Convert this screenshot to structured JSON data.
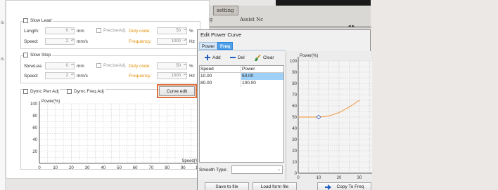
{
  "left_edge": {
    "marks": [
      "/s",
      "/s"
    ]
  },
  "background_window": {
    "tab_setting": "setting",
    "tab_partial": "ing",
    "tab_assist": "Assist Nc"
  },
  "slow_lead": {
    "label": "Slow Lead",
    "length_label": "Length:",
    "length_value": "0",
    "length_unit": "mm",
    "precise_label": "PreciseAdj.",
    "duty_label": "Duty code:",
    "duty_value": "50",
    "duty_unit": "%",
    "speed_label": "Speed:",
    "speed_value": "2",
    "speed_unit": "mm/s",
    "freq_label": "Frequency:",
    "freq_value": "1000",
    "freq_unit": "Hz"
  },
  "slow_stop": {
    "label": "Slow Stop",
    "length_label": "SlowLea",
    "length_value": "0",
    "length_unit": "mm",
    "precise_label": "PreciseAdj.",
    "duty_label": "Duty code:",
    "duty_value": "50",
    "duty_unit": "%",
    "speed_label": "Speed:",
    "speed_value": "2",
    "speed_unit": "mm/s",
    "freq_label": "Frequency:",
    "freq_value": "1000",
    "freq_unit": "Hz"
  },
  "dynamic": {
    "pwr_label": "Dymc Pwr Adj",
    "freq_label": "Dymc Freq Adj",
    "curve_button": "Curve edit"
  },
  "chart_data": [
    {
      "type": "line",
      "title": "",
      "ylabel": "Power(%)",
      "xlabel": "Speed(%)",
      "xlim": [
        0,
        100
      ],
      "ylim": [
        0,
        100
      ],
      "x_ticks": [
        0,
        10,
        20,
        30,
        40,
        50,
        60,
        70,
        80,
        90,
        100
      ],
      "y_ticks": [
        20,
        40,
        60,
        80,
        100
      ],
      "grid": true,
      "series": []
    },
    {
      "type": "line",
      "title": "",
      "ylabel": "Power(%)",
      "xlabel": "",
      "xlim": [
        0,
        30
      ],
      "ylim": [
        0,
        100
      ],
      "x_ticks": [
        0,
        10,
        20,
        30
      ],
      "y_ticks": [
        0,
        10,
        20,
        30,
        40,
        50,
        60,
        70,
        80,
        90,
        100
      ],
      "grid": true,
      "series": [
        {
          "x": [
            0,
            10,
            15,
            20,
            25,
            30
          ],
          "y": [
            50,
            50,
            51,
            54,
            59,
            65
          ]
        }
      ],
      "points": [
        {
          "x": 10,
          "y": 50
        }
      ]
    }
  ],
  "dialog": {
    "title": "Edit Power Curve",
    "tabs": [
      "Power",
      "Freq"
    ],
    "toolbar": {
      "add": "Add",
      "del": "Del",
      "clear": "Clear"
    },
    "table": {
      "headers": [
        "Speed",
        "Power"
      ],
      "rows": [
        [
          "10.00",
          "50.00"
        ],
        [
          "80.00",
          "100.00"
        ]
      ]
    },
    "smooth_label": "Smooth Type:",
    "smooth_value": "",
    "buttons": {
      "save": "Save to file",
      "load": "Load form file",
      "copy": "Copy To Freq"
    },
    "colors": {
      "curve": "#f2a256",
      "selection": "#9fd0f8",
      "accent": "#e0703a"
    }
  }
}
